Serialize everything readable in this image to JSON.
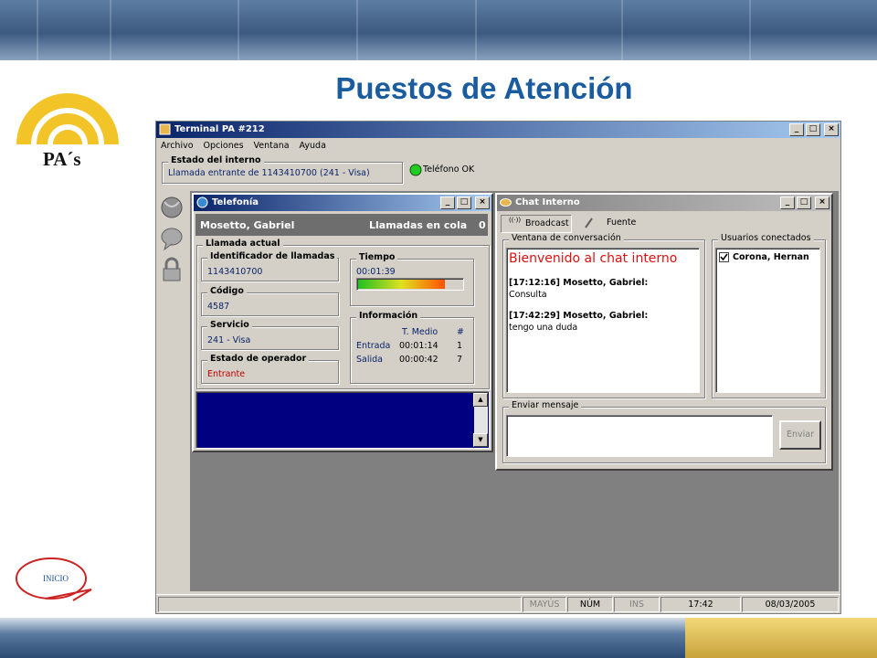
{
  "slide": {
    "title": "Puestos de Atención",
    "logo_text": "PA´s",
    "home_link": "INICIO"
  },
  "app": {
    "title": "Terminal PA #212",
    "menu": [
      "Archivo",
      "Opciones",
      "Ventana",
      "Ayuda"
    ],
    "extension_status": {
      "label": "Estado del interno",
      "value": "Llamada entrante de 1143410700 (241 - Visa)"
    },
    "phone_status": {
      "label": "Teléfono OK",
      "color": "#22cc22"
    },
    "side_icons": [
      "phone-globe-icon",
      "chat-bubble-icon",
      "lock-icon"
    ]
  },
  "telephony": {
    "title": "Telefonía",
    "agent": "Mosetto, Gabriel",
    "queue_label": "Llamadas en cola",
    "queue_count": "0",
    "current_call_label": "Llamada actual",
    "caller_id_label": "Identificador de llamadas",
    "caller_id": "1143410700",
    "code_label": "Código",
    "code": "4587",
    "service_label": "Servicio",
    "service": "241 - Visa",
    "operator_state_label": "Estado de operador",
    "operator_state": "Entrante",
    "time_label": "Tiempo",
    "time": "00:01:39",
    "time_progress": 0.85,
    "info_label": "Información",
    "info_headers": [
      "",
      "T. Medio",
      "#"
    ],
    "info_rows": [
      [
        "Entrada",
        "00:01:14",
        "1"
      ],
      [
        "Salida",
        "00:00:42",
        "7"
      ]
    ]
  },
  "chat": {
    "title": "Chat Interno",
    "broadcast_label": "Broadcast",
    "font_label": "Fuente",
    "conversation_label": "Ventana de conversación",
    "welcome": "Bienvenido al chat interno",
    "messages": [
      {
        "header": "[17:12:16] Mosetto, Gabriel:",
        "text": "Consulta"
      },
      {
        "header": "[17:42:29] Mosetto, Gabriel:",
        "text": "tengo una duda"
      }
    ],
    "users_label": "Usuarios conectados",
    "users": [
      "Corona, Hernan"
    ],
    "send_label": "Enviar mensaje",
    "send_button": "Enviar"
  },
  "statusbar": {
    "caps": "MAYÚS",
    "num": "NÚM",
    "ins": "INS",
    "time": "17:42",
    "date": "08/03/2005"
  }
}
